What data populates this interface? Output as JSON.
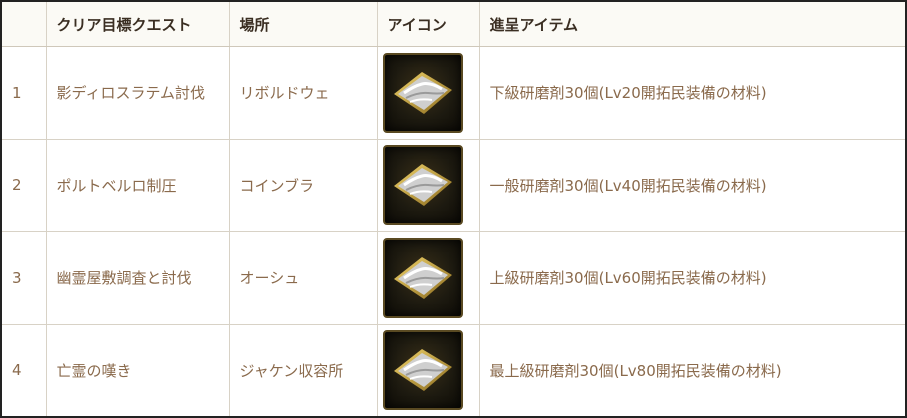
{
  "table": {
    "headers": {
      "num": "",
      "quest": "クリア目標クエスト",
      "location": "場所",
      "icon": "アイコン",
      "item": "進呈アイテム"
    },
    "rows": [
      {
        "num": "1",
        "quest": "影ディロスラテム討伐",
        "location": "リボルドウェ",
        "icon": "polishing-compound-icon",
        "item": "下級研磨剤30個(Lv20開拓民装備の材料)"
      },
      {
        "num": "2",
        "quest": "ポルトベルロ制圧",
        "location": "コインブラ",
        "icon": "polishing-compound-icon",
        "item": "一般研磨剤30個(Lv40開拓民装備の材料)"
      },
      {
        "num": "3",
        "quest": "幽霊屋敷調査と討伐",
        "location": "オーシュ",
        "icon": "polishing-compound-icon",
        "item": "上級研磨剤30個(Lv60開拓民装備の材料)"
      },
      {
        "num": "4",
        "quest": "亡霊の嘆き",
        "location": "ジャケン収容所",
        "icon": "polishing-compound-icon",
        "item": "最上級研磨剤30個(Lv80開拓民装備の材料)"
      }
    ]
  },
  "colors": {
    "header_text": "#3a2e22",
    "body_text": "#8a6a4c",
    "border": "#d8d2c6",
    "frame": "#222222",
    "icon_gold": "#c9a640"
  }
}
